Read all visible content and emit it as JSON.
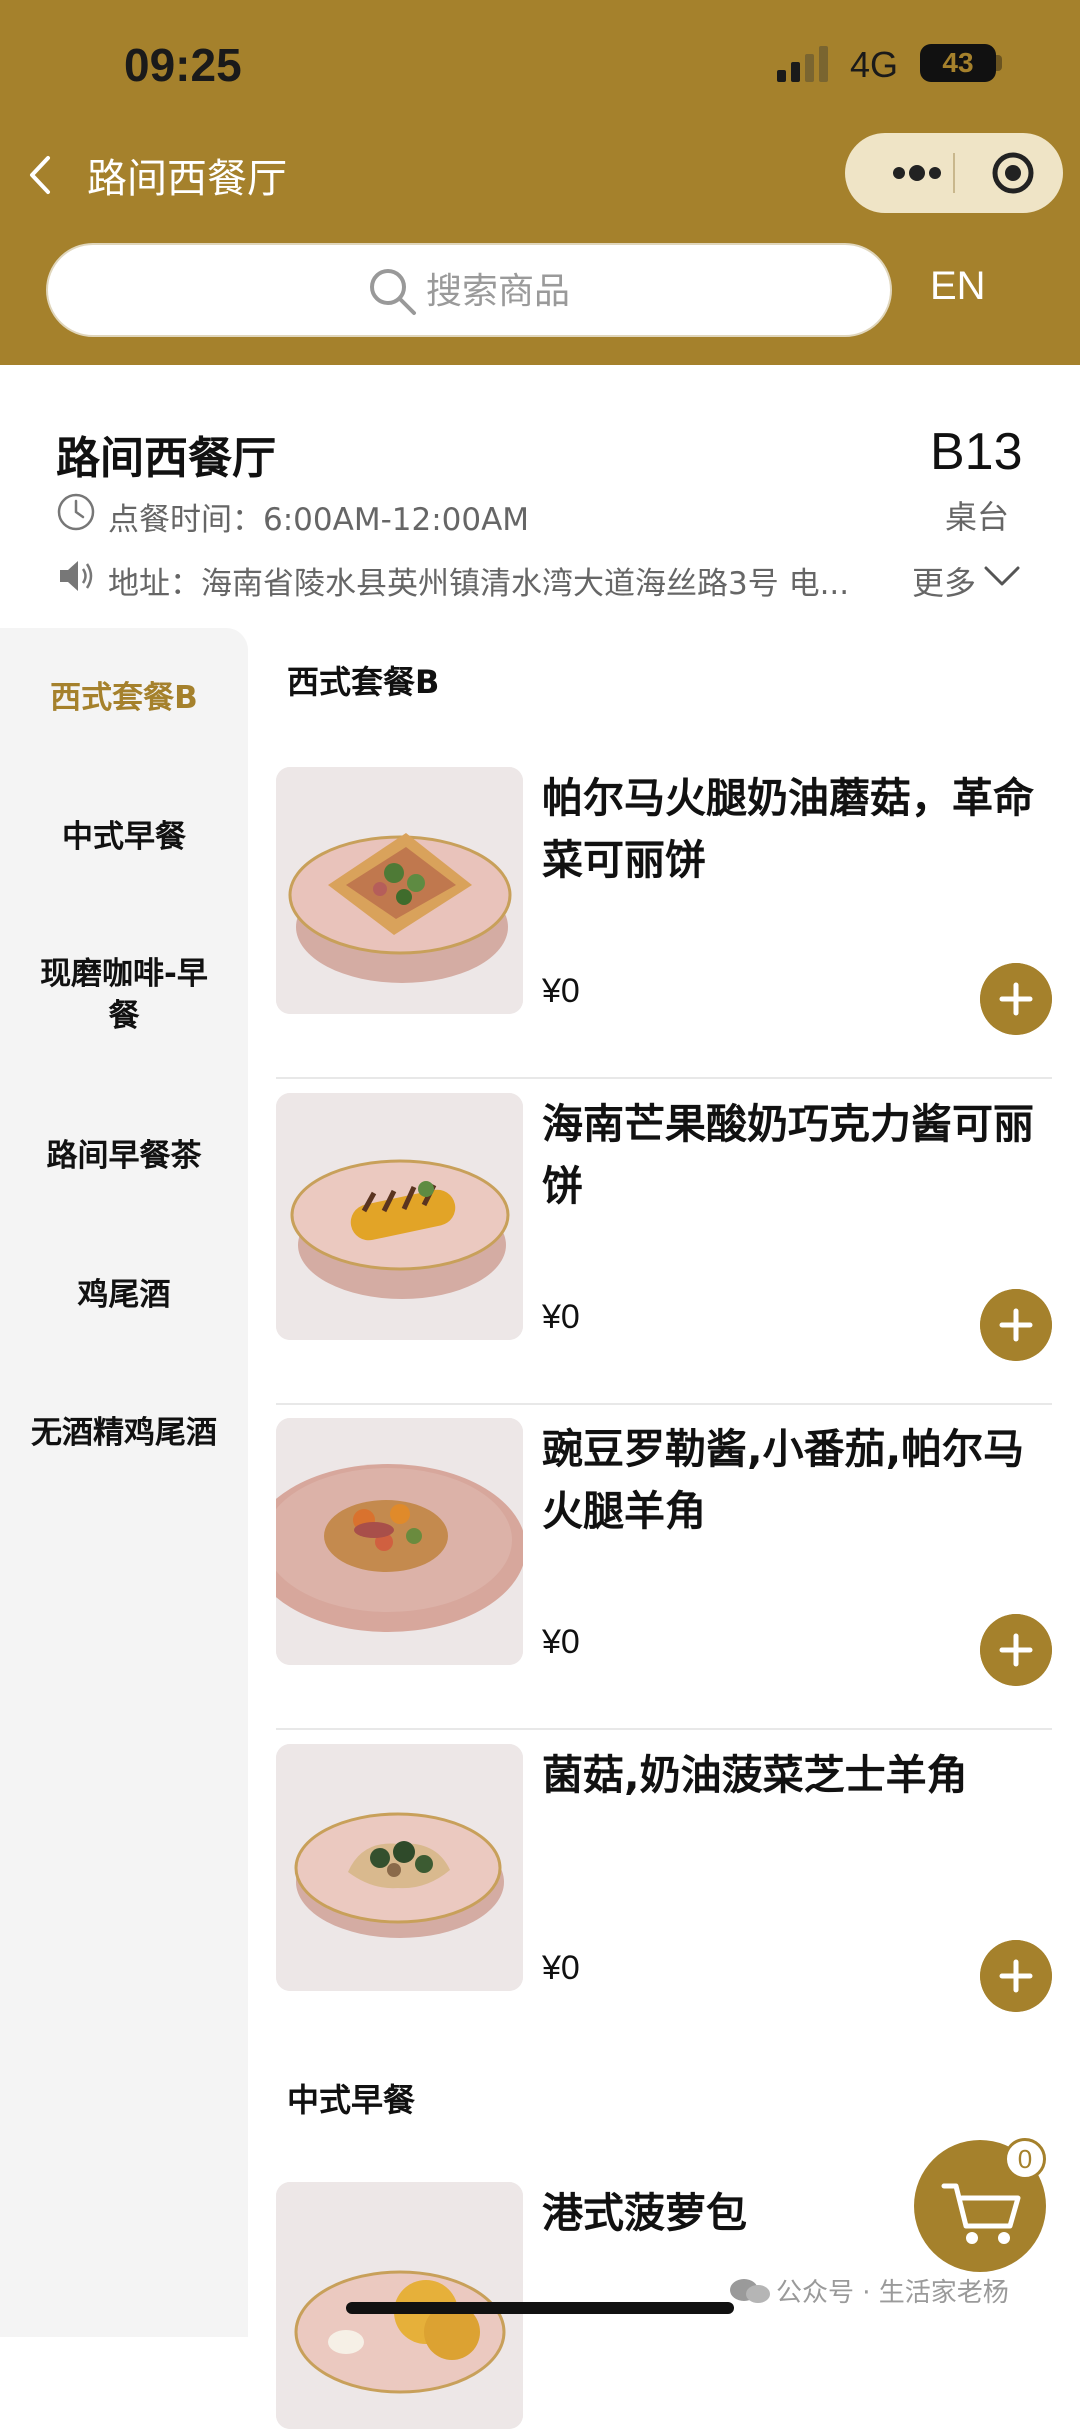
{
  "status_bar": {
    "time": "09:25",
    "network": "4G",
    "battery": "43"
  },
  "nav": {
    "title": "路间西餐厅"
  },
  "search": {
    "placeholder": "搜索商品"
  },
  "language_toggle": "EN",
  "store": {
    "name": "路间西餐厅",
    "hours": "点餐时间：6:00AM-12:00AM",
    "address": "地址：海南省陵水县英州镇清水湾大道海丝路3号 电...",
    "more_label": "更多",
    "table_number": "B13",
    "table_label": "桌台"
  },
  "categories": [
    {
      "label": "西式套餐B",
      "active": true
    },
    {
      "label": "中式早餐"
    },
    {
      "label": "现磨咖啡-早餐"
    },
    {
      "label": "路间早餐茶"
    },
    {
      "label": "鸡尾酒"
    },
    {
      "label": "无酒精鸡尾酒"
    }
  ],
  "sections": [
    {
      "title": "西式套餐B",
      "items": [
        {
          "name": "帕尔马火腿奶油蘑菇，革命菜可丽饼",
          "price": "¥0"
        },
        {
          "name": "海南芒果酸奶巧克力酱可丽饼",
          "price": "¥0"
        },
        {
          "name": "豌豆罗勒酱,小番茄,帕尔马火腿羊角",
          "price": "¥0"
        },
        {
          "name": "菌菇,奶油菠菜芝士羊角",
          "price": "¥0"
        }
      ]
    },
    {
      "title": "中式早餐",
      "items": [
        {
          "name": "港式菠萝包"
        }
      ]
    }
  ],
  "cart": {
    "count": "0"
  },
  "watermark": "公众号 · 生活家老杨",
  "colors": {
    "accent": "#a5812c",
    "capsule": "#efe4c6",
    "sidebar": "#f4f4f4"
  }
}
